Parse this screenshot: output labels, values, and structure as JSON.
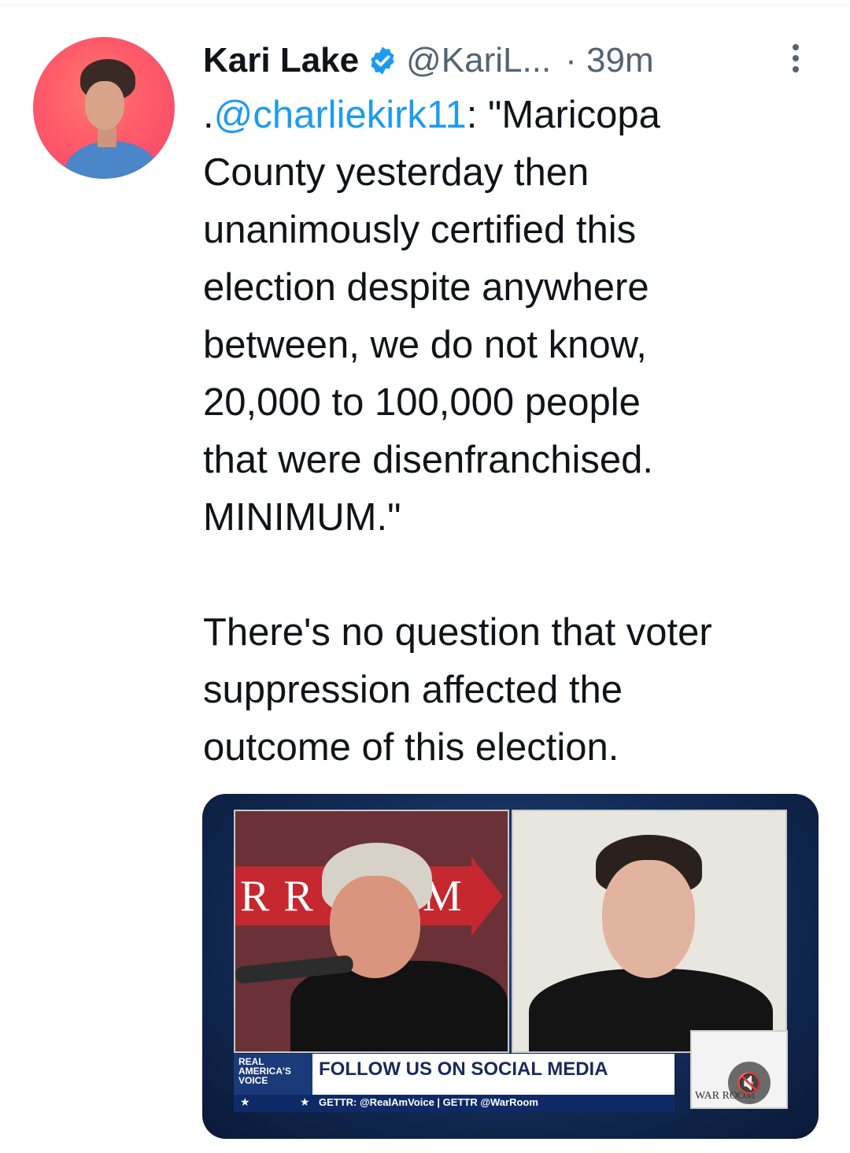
{
  "tweet": {
    "author_name": "Kari Lake",
    "handle": "@KariL...",
    "time": "· 39m",
    "text_prefix": ".",
    "mention": "@charliekirk11",
    "text_body": ": \"Maricopa\nCounty yesterday then\nunanimously certified this\nelection despite anywhere\nbetween, we do not know,\n20,000 to 100,000 people\nthat were disenfranchised.\nMINIMUM.\"\n\nThere's no question that voter\nsuppression affected the\noutcome of this election."
  },
  "icons": {
    "verified": "verified-badge-icon",
    "more": "more-options-icon",
    "mute": "mute-icon"
  },
  "colors": {
    "link": "#1d9bf0",
    "secondary_text": "#536471",
    "verified": "#1d9bf0"
  },
  "media": {
    "left_banner_text_1": "R R",
    "left_banner_text_2": "M",
    "channel_label": "REAL AMERICA'S VOICE",
    "lower_third_title": "FOLLOW US ON SOCIAL MEDIA",
    "lower_third_sub": "GETTR: @RealAmVoice | GETTR @WarRoom",
    "logo_text": "WAR ROOM",
    "mute_glyph": "🔇"
  }
}
